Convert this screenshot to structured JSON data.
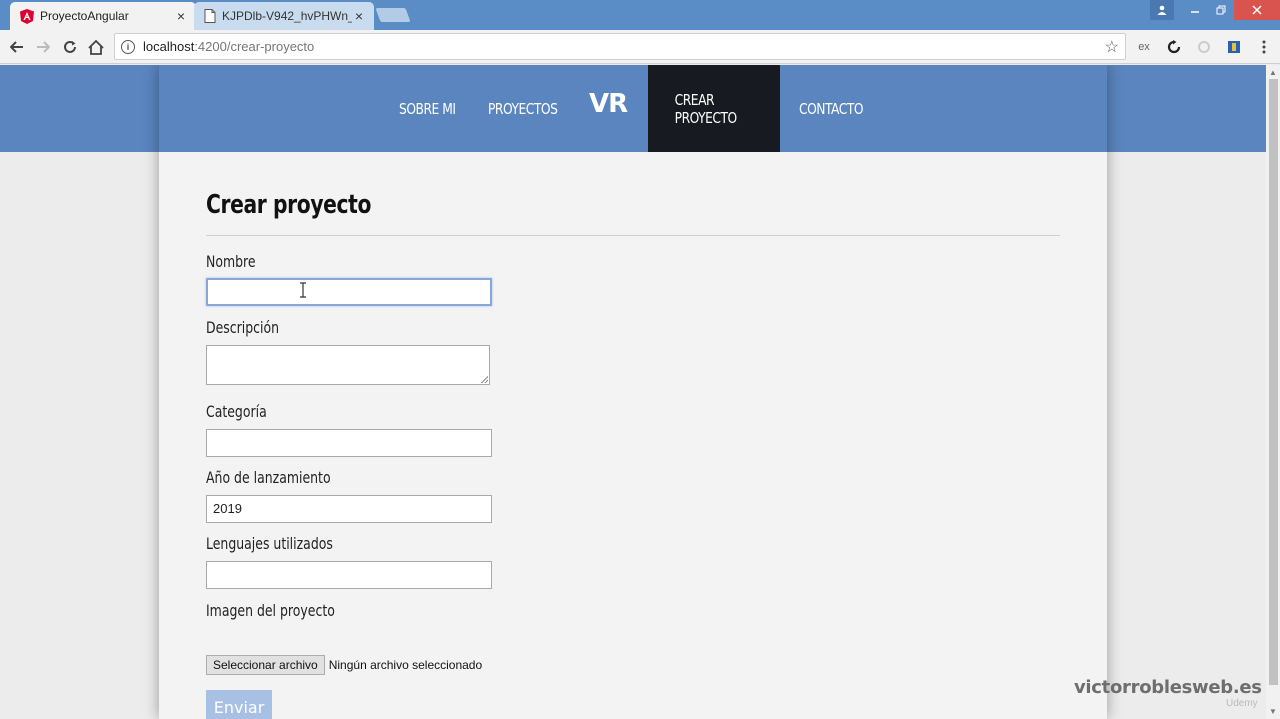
{
  "browser": {
    "tabs": [
      {
        "title": "ProyectoAngular",
        "icon": "angular-icon",
        "active": true
      },
      {
        "title": "KJPDlb-V942_hvPHWn_S",
        "icon": "document-icon",
        "active": false
      }
    ],
    "close_glyph": "×",
    "address": {
      "host": "localhost",
      "path": ":4200/crear-proyecto"
    },
    "extensions": [
      "ex"
    ]
  },
  "nav": {
    "items": [
      "SOBRE MI",
      "PROYECTOS",
      "CREAR PROYECTO",
      "CONTACTO"
    ],
    "logo": "VR",
    "active": "CREAR PROYECTO"
  },
  "form": {
    "title": "Crear proyecto",
    "fields": {
      "nombre": {
        "label": "Nombre",
        "value": ""
      },
      "descripcion": {
        "label": "Descripción",
        "value": ""
      },
      "categoria": {
        "label": "Categoría",
        "value": ""
      },
      "anio": {
        "label": "Año de lanzamiento",
        "value": "2019"
      },
      "lenguajes": {
        "label": "Lenguajes utilizados",
        "value": ""
      },
      "imagen": {
        "label": "Imagen del proyecto"
      }
    },
    "file_button": "Seleccionar archivo",
    "file_status": "Ningún archivo seleccionado",
    "submit": "Enviar"
  },
  "watermark": "victorroblesweb.es",
  "udemy_mark": "Udemy",
  "colors": {
    "header": "#5a85bf",
    "active_nav": "#171a21",
    "submit": "#a7c0e3",
    "tabbar": "#5a8cc6"
  }
}
